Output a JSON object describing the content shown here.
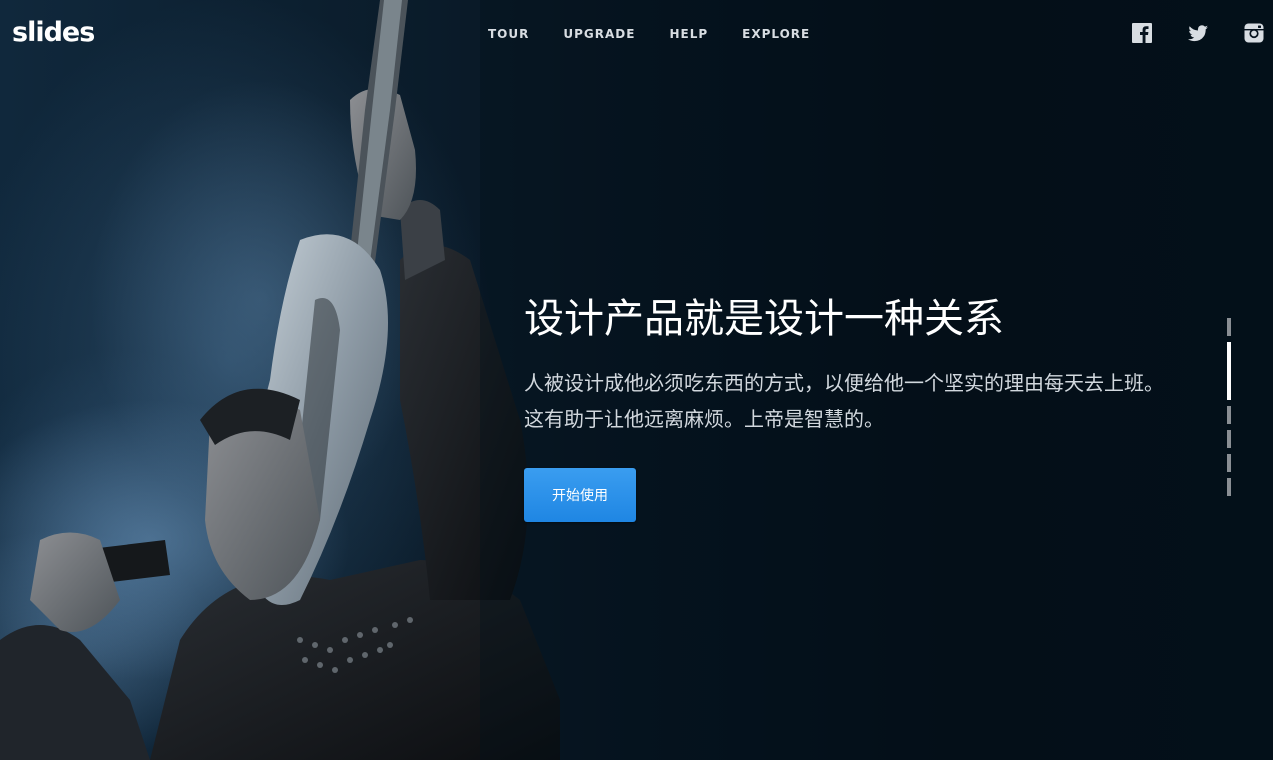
{
  "header": {
    "logo": "slides",
    "nav": [
      "TOUR",
      "UPGRADE",
      "HELP",
      "EXPLORE"
    ],
    "social_icons": [
      "facebook-icon",
      "twitter-icon",
      "instagram-icon"
    ]
  },
  "hero": {
    "title": "设计产品就是设计一种关系",
    "description": "人被设计成他必须吃东西的方式，以便给他一个坚实的理由每天去上班。这有助于让他远离麻烦。上帝是智慧的。",
    "cta_label": "开始使用"
  },
  "pager": {
    "total": 6,
    "active_index": 1
  },
  "colors": {
    "accent": "#2f93ec",
    "background": "#05101a",
    "text": "#ffffff"
  }
}
